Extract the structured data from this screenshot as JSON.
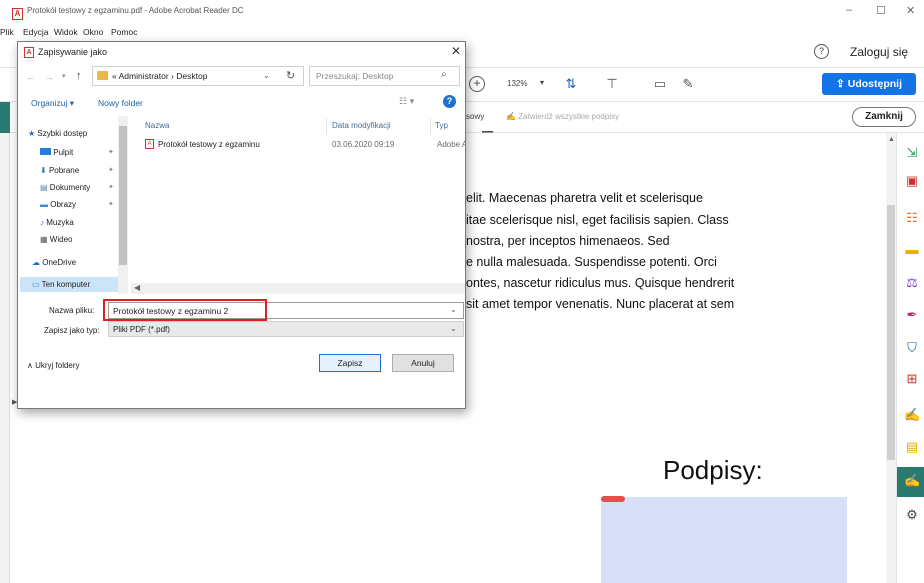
{
  "window": {
    "title": "Protokół testowy z egzaminu.pdf - Adobe Acrobat Reader DC",
    "min": "–",
    "max": "☐",
    "close": "✕"
  },
  "menu": [
    "Plik",
    "Edycja",
    "Widok",
    "Okno",
    "Pomoc"
  ],
  "header": {
    "help": "?",
    "login": "Zaloguj się"
  },
  "toolbar": {
    "zoom_plus": "+",
    "zoom": "132%",
    "zoom_caret": "▾",
    "share": "Udostępnij"
  },
  "fill_sign": {
    "left_fragment": "sowy",
    "confirm_all": "Zatwierdź wszystkie podpisy",
    "close": "Zamknij"
  },
  "document": {
    "heading_fragment": "–",
    "lines": [
      "elit. Maecenas pharetra velit et scelerisque",
      "itae scelerisque nisl, eget facilisis sapien. Class",
      "nostra, per inceptos himenaeos. Sed",
      "e nulla malesuada. Suspendisse potenti. Orci",
      "ontes, nascetur ridiculus mus. Quisque hendrerit",
      "sit amet tempor venenatis. Nunc placerat at sem"
    ],
    "signatures_title": "Podpisy:"
  },
  "dialog": {
    "title": "Zapisywanie jako",
    "close": "✕",
    "address": "« Administrator › Desktop",
    "search_placeholder": "Przeszukaj: Desktop",
    "organize": "Organizuj ▾",
    "new_folder": "Nowy folder",
    "help": "?",
    "nav_items": [
      {
        "label": "Szybki dostęp"
      },
      {
        "label": "Pulpit"
      },
      {
        "label": "Pobrane"
      },
      {
        "label": "Dokumenty"
      },
      {
        "label": "Obrazy"
      },
      {
        "label": "Muzyka"
      },
      {
        "label": "Wideo"
      },
      {
        "label": "OneDrive"
      },
      {
        "label": "Ten komputer"
      }
    ],
    "columns": {
      "name": "Nazwa",
      "date": "Data modyfikacji",
      "type": "Typ"
    },
    "files": [
      {
        "name": "Protokół testowy z egzaminu",
        "date": "03.06.2020 09:19",
        "type": "Adobe Acrobat"
      }
    ],
    "file_name_label": "Nazwa pliku:",
    "file_name_value": "Protokół testowy z egzaminu 2",
    "file_type_label": "Zapisz jako typ:",
    "file_type_value": "Pliki PDF (*.pdf)",
    "hide_folders": "Ukryj foldery",
    "save": "Zapisz",
    "cancel": "Anuluj"
  },
  "colors": {
    "accent": "#1473e6",
    "teal": "#2a7b6f",
    "highlight_red": "#e02020",
    "signature_box": "#d8e0f7"
  }
}
